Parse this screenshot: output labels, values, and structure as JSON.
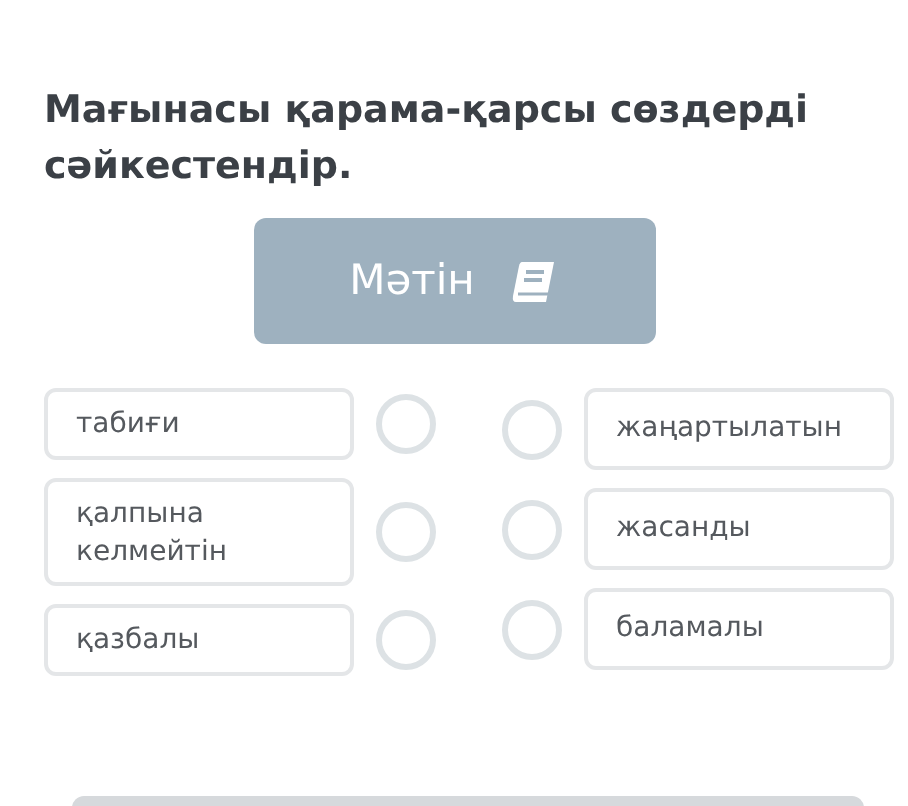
{
  "title": "Мағынасы қарама-қарсы сөздерді сәйкестендір.",
  "text_button": {
    "label": "Мәтін"
  },
  "left_items": [
    {
      "label": "табиғи"
    },
    {
      "label": "қалпына келмейтін"
    },
    {
      "label": "қазбалы"
    }
  ],
  "right_items": [
    {
      "label": "жаңартылатын"
    },
    {
      "label": "жасанды"
    },
    {
      "label": "баламалы"
    }
  ]
}
